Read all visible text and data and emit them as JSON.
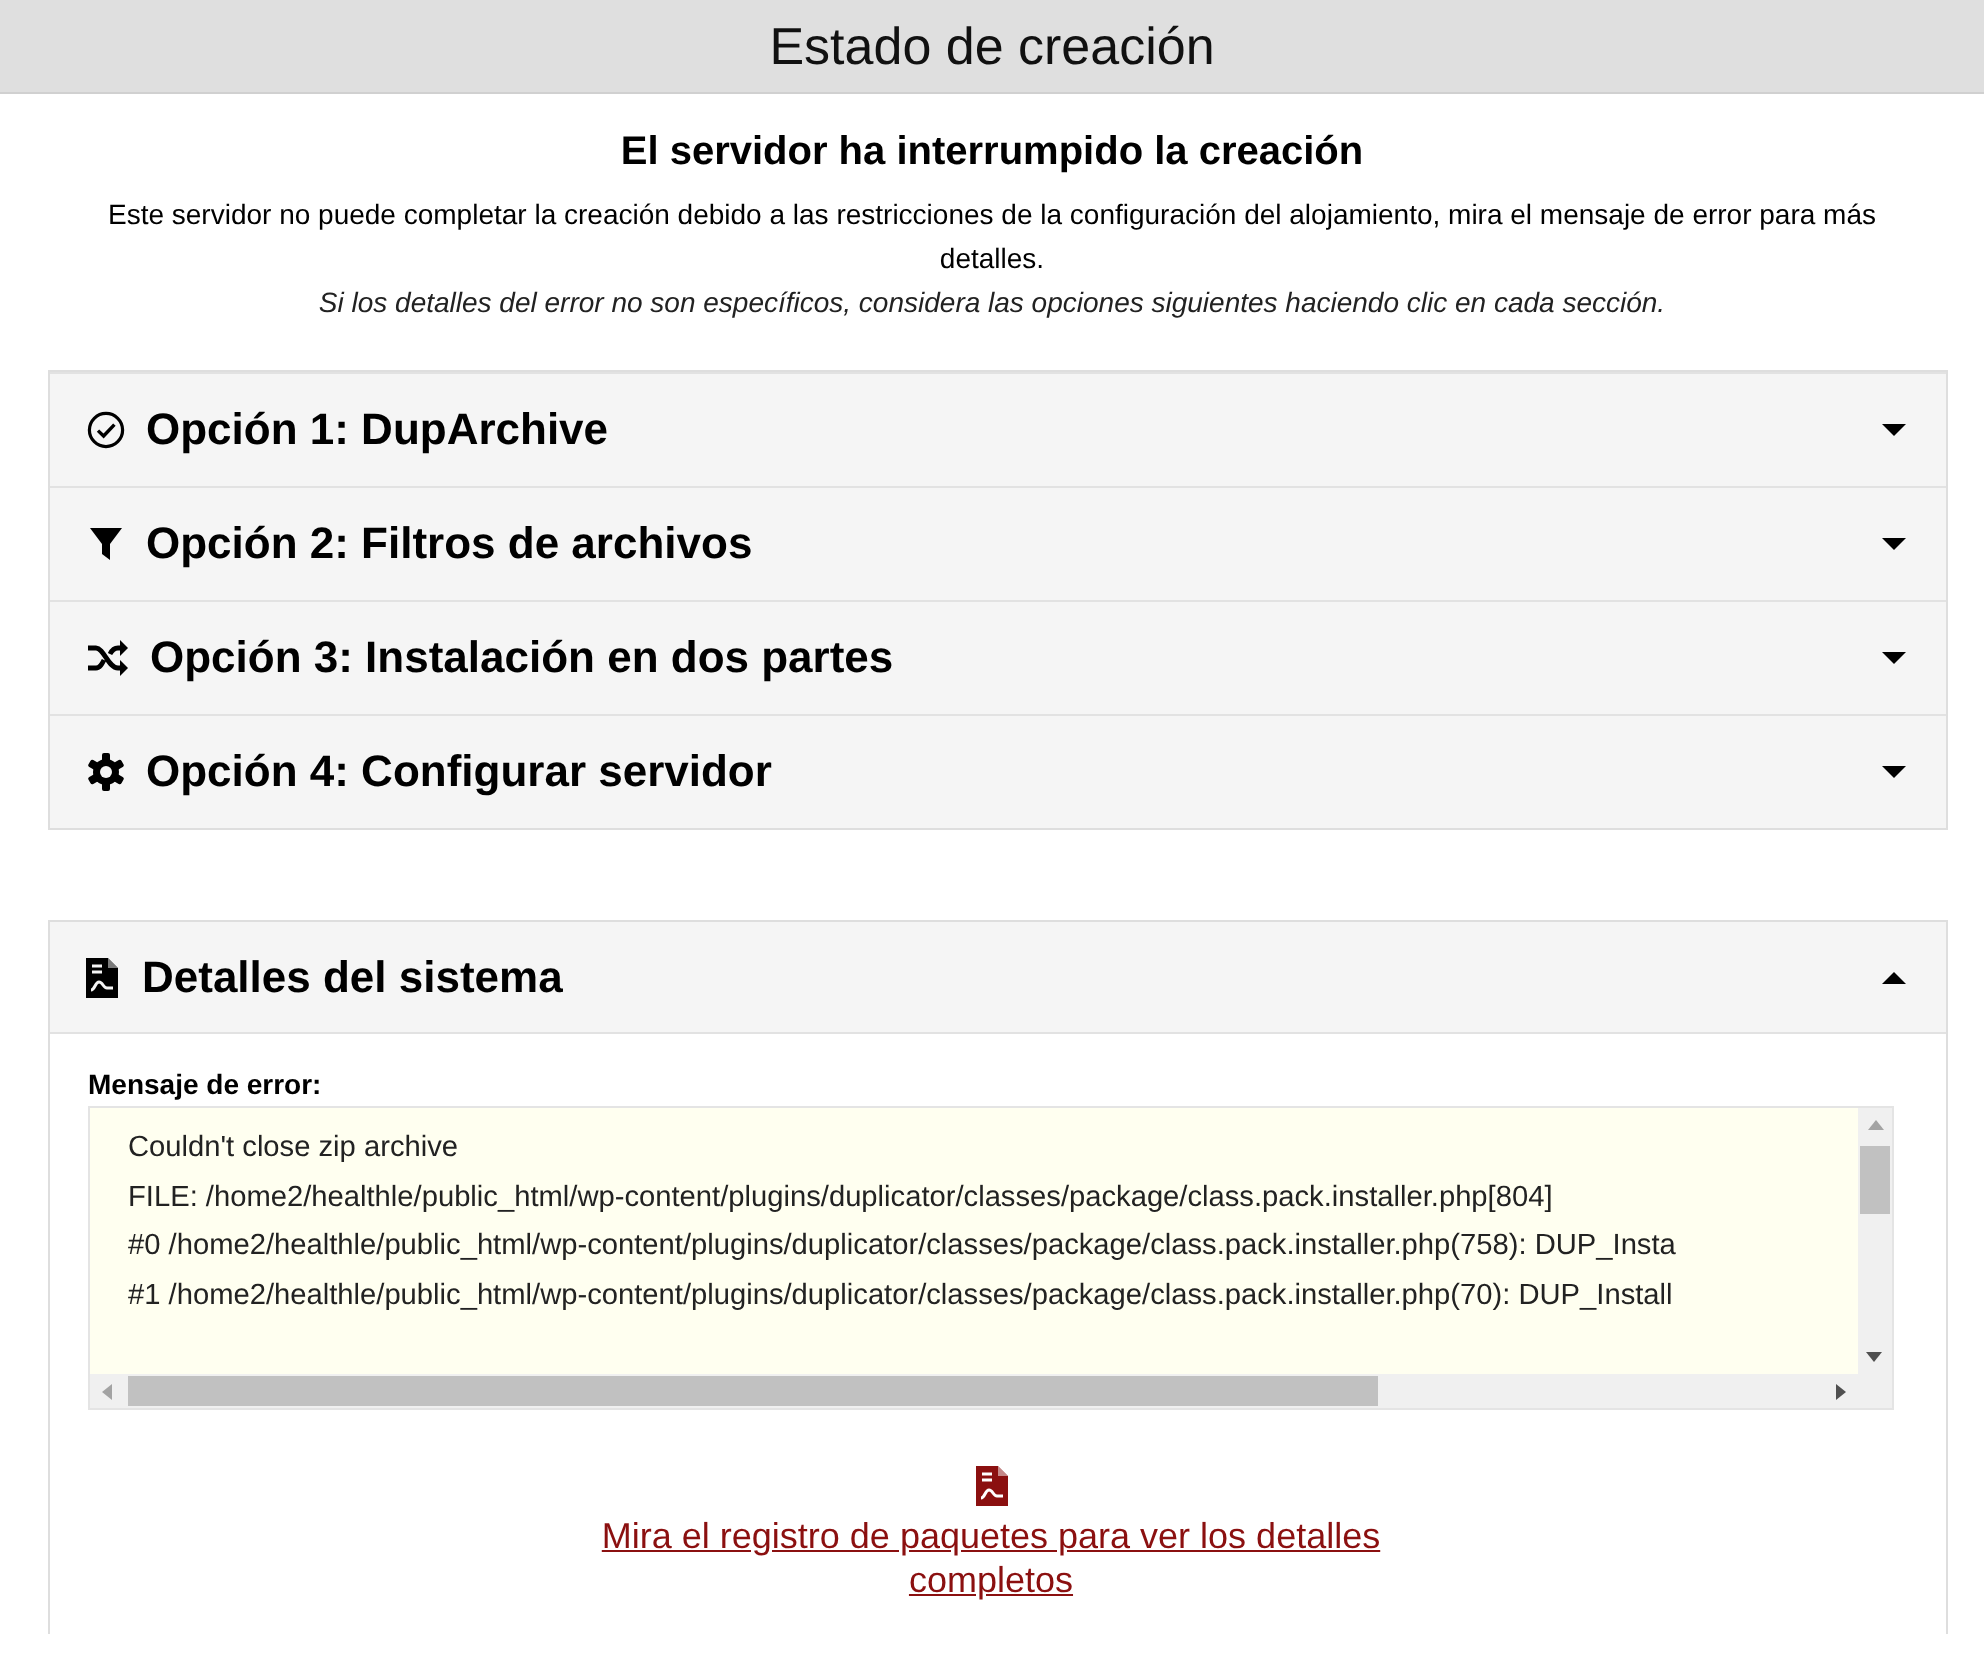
{
  "header": {
    "title": "Estado de creación"
  },
  "notice": {
    "heading": "El servidor ha interrumpido la creación",
    "message": "Este servidor no puede completar la creación debido a las restricciones de la configuración del alojamiento, mira el mensaje de error para más detalles.",
    "hint": "Si los detalles del error no son específicos, considera las opciones siguientes haciendo clic en cada sección."
  },
  "options": [
    {
      "title": "Opción 1: DupArchive",
      "expanded": false
    },
    {
      "title": "Opción 2: Filtros de archivos",
      "expanded": false
    },
    {
      "title": "Opción 3: Instalación en dos partes",
      "expanded": false
    },
    {
      "title": "Opción 4: Configurar servidor",
      "expanded": false
    }
  ],
  "system_details": {
    "title": "Detalles del sistema",
    "expanded": true,
    "error_label": "Mensaje de error:",
    "log_lines": [
      "Couldn't close zip archive",
      "FILE: /home2/healthle/public_html/wp-content/plugins/duplicator/classes/package/class.pack.installer.php[804]",
      "#0 /home2/healthle/public_html/wp-content/plugins/duplicator/classes/package/class.pack.installer.php(758): DUP_Insta",
      "#1 /home2/healthle/public_html/wp-content/plugins/duplicator/classes/package/class.pack.installer.php(70): DUP_Install"
    ],
    "log_link": "Mira el registro de paquetes para ver los detalles completos"
  }
}
